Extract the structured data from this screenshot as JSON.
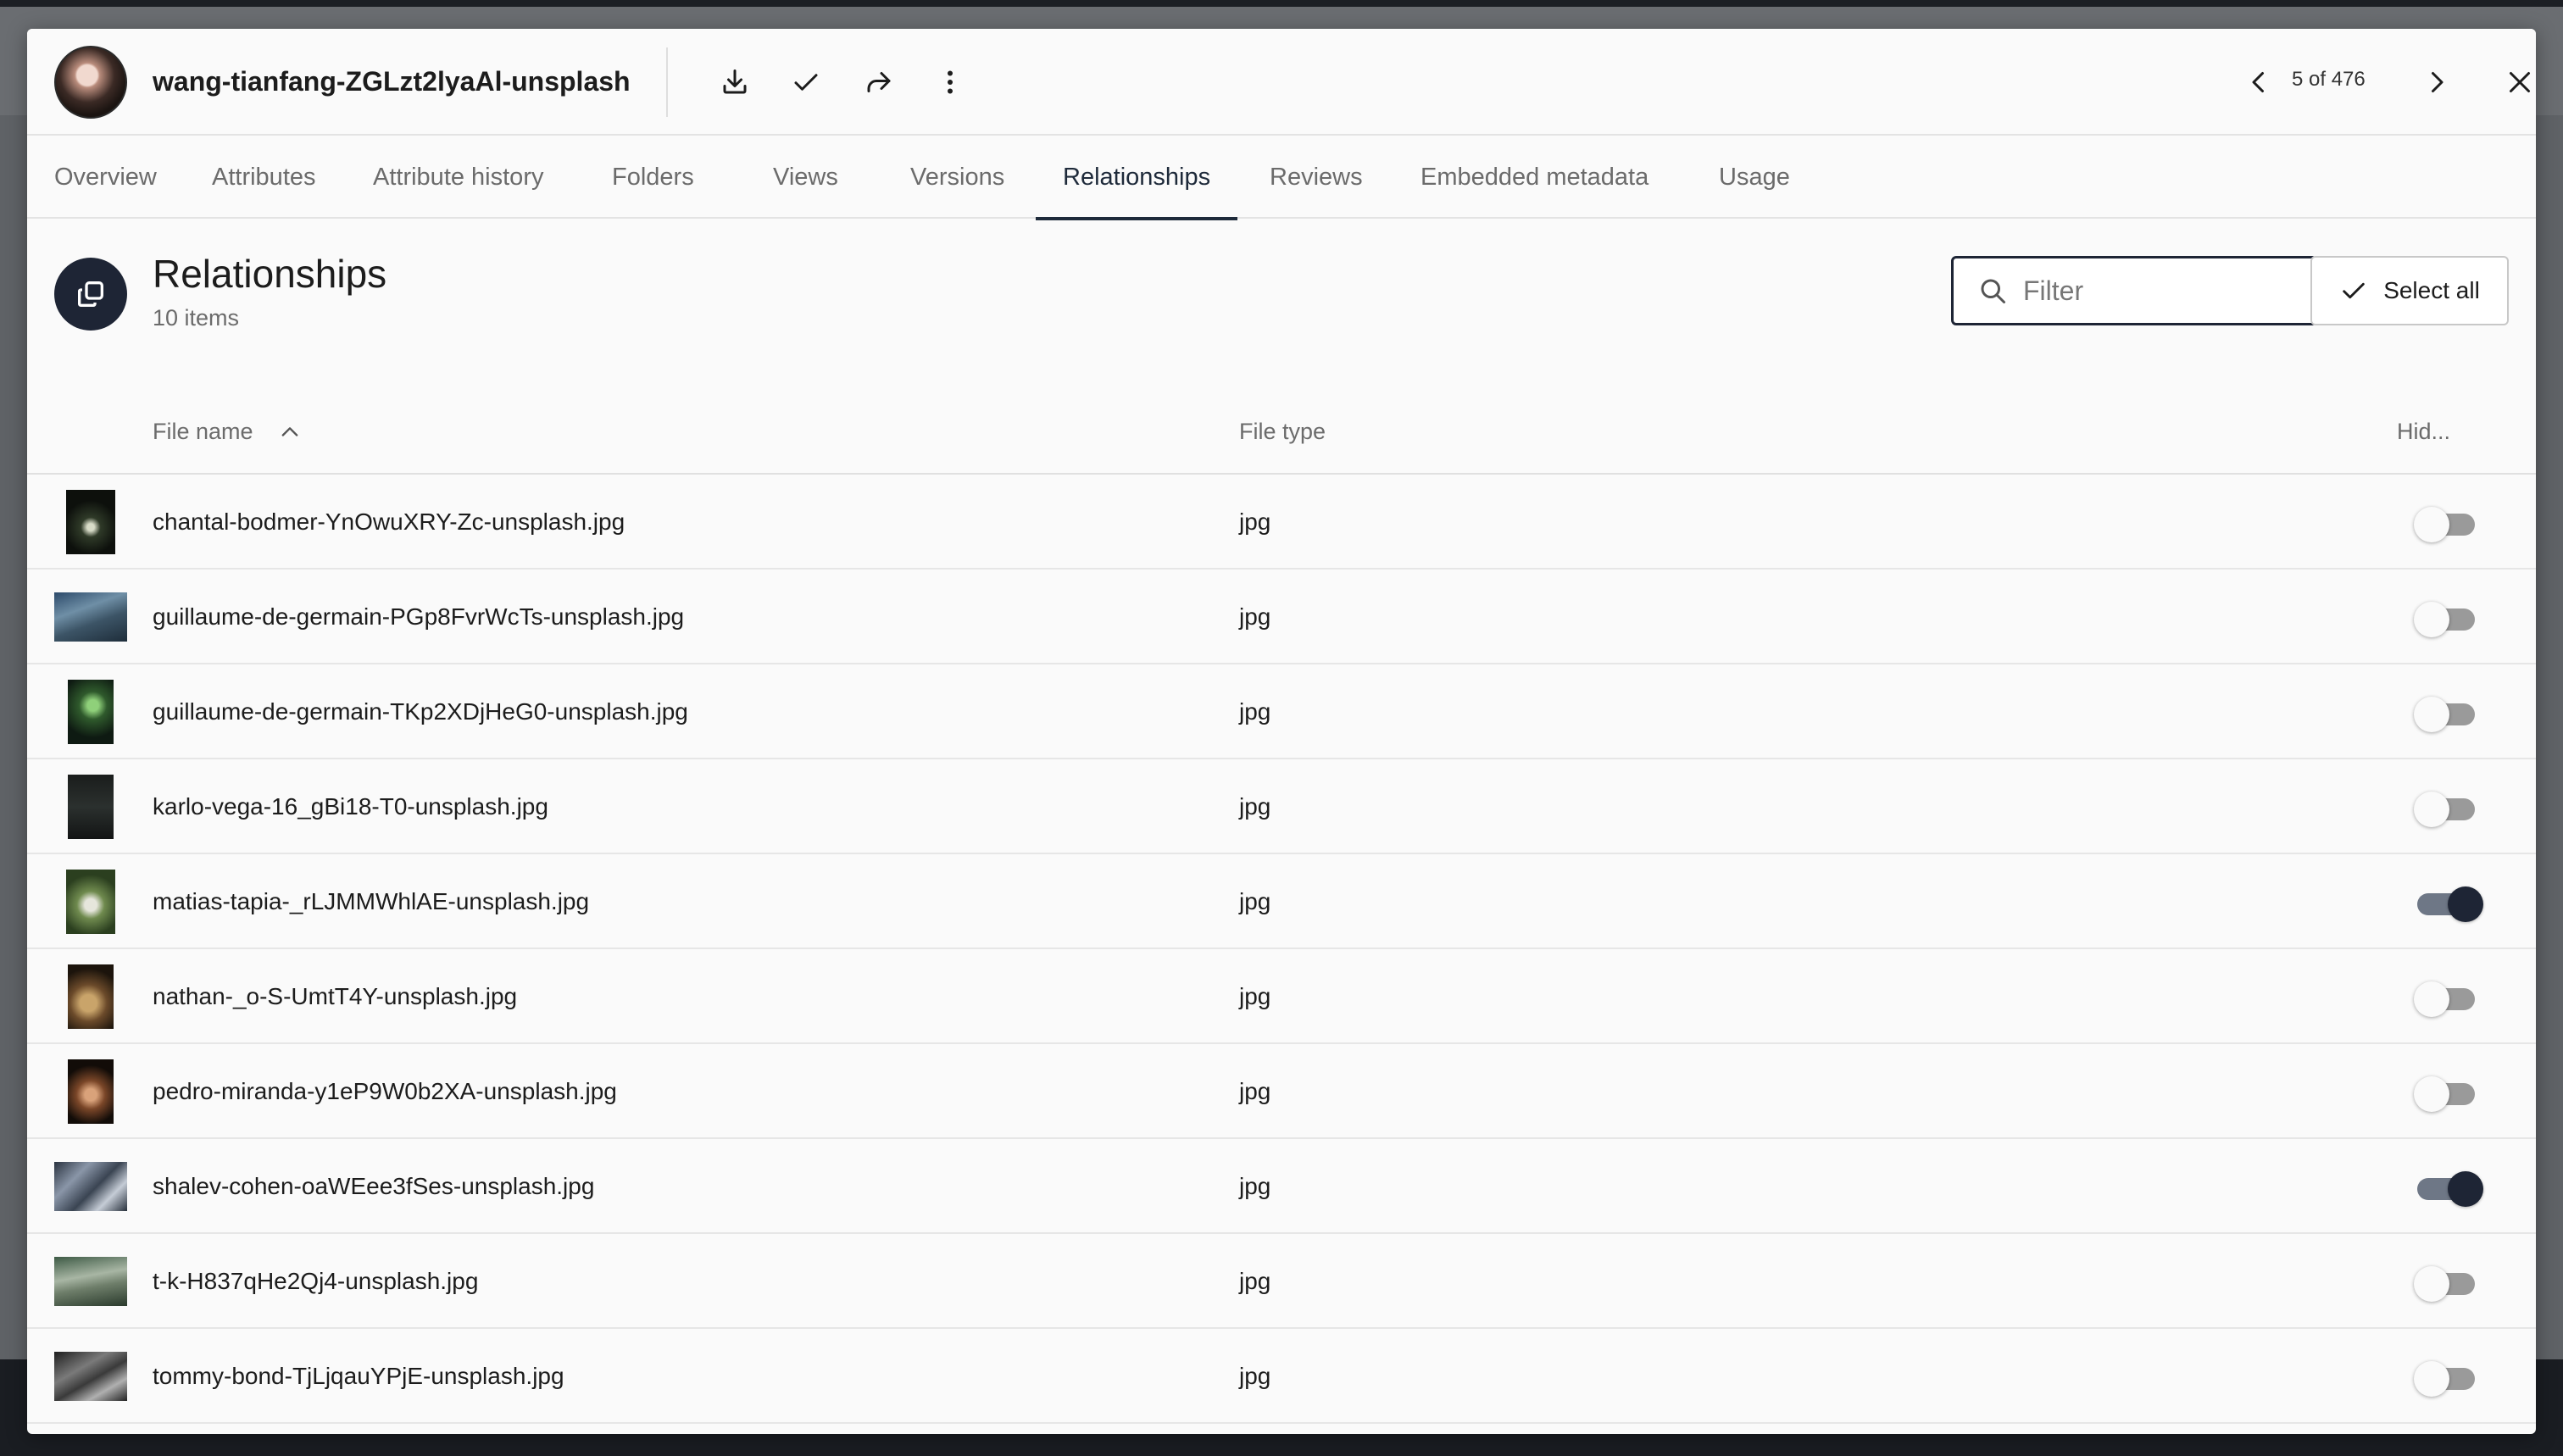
{
  "asset": {
    "title": "wang-tianfang-ZGLzt2lyaAl-unsplash"
  },
  "toolbar": {
    "icons": [
      "download-icon",
      "check-icon",
      "share-icon",
      "more-vertical-icon"
    ]
  },
  "pager": {
    "text": "5 of 476"
  },
  "tabs": [
    {
      "label": "Overview"
    },
    {
      "label": "Attributes"
    },
    {
      "label": "Attribute history"
    },
    {
      "label": "Folders"
    },
    {
      "label": "Views"
    },
    {
      "label": "Versions"
    },
    {
      "label": "Relationships"
    },
    {
      "label": "Reviews"
    },
    {
      "label": "Embedded metadata"
    },
    {
      "label": "Usage"
    }
  ],
  "active_tab": "Relationships",
  "section": {
    "title": "Relationships",
    "count": "10 items"
  },
  "filter": {
    "placeholder": "Filter",
    "value": ""
  },
  "select_all_label": "Select all",
  "table": {
    "columns": [
      "File name",
      "File type",
      "Hid..."
    ],
    "sort": {
      "column": "File name",
      "direction": "ascending"
    },
    "rows": [
      {
        "name": "chantal-bodmer-YnOwuXRY-Zc-unsplash.jpg",
        "type": "jpg",
        "hidden": false
      },
      {
        "name": "guillaume-de-germain-PGp8FvrWcTs-unsplash.jpg",
        "type": "jpg",
        "hidden": false
      },
      {
        "name": "guillaume-de-germain-TKp2XDjHeG0-unsplash.jpg",
        "type": "jpg",
        "hidden": false
      },
      {
        "name": "karlo-vega-16_gBi18-T0-unsplash.jpg",
        "type": "jpg",
        "hidden": false
      },
      {
        "name": "matias-tapia-_rLJMMWhlAE-unsplash.jpg",
        "type": "jpg",
        "hidden": true
      },
      {
        "name": "nathan-_o-S-UmtT4Y-unsplash.jpg",
        "type": "jpg",
        "hidden": false
      },
      {
        "name": "pedro-miranda-y1eP9W0b2XA-unsplash.jpg",
        "type": "jpg",
        "hidden": false
      },
      {
        "name": "shalev-cohen-oaWEee3fSes-unsplash.jpg",
        "type": "jpg",
        "hidden": true
      },
      {
        "name": "t-k-H837qHe2Qj4-unsplash.jpg",
        "type": "jpg",
        "hidden": false
      },
      {
        "name": "tommy-bond-TjLjqauYPjE-unsplash.jpg",
        "type": "jpg",
        "hidden": false
      }
    ]
  },
  "colors": {
    "accent": "#1e2535",
    "text": "#1c1c1c",
    "muted": "#6b6b6b"
  }
}
